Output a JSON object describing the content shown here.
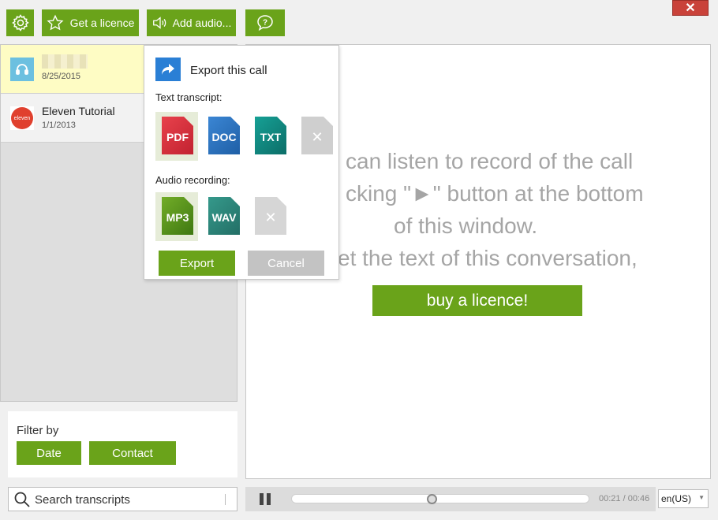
{
  "toolbar": {
    "settings_icon": "gear-icon",
    "licence_label": "Get a licence",
    "licence_icon": "star-icon",
    "audio_label": "Add audio...",
    "audio_icon": "speaker-icon",
    "help_icon": "question-bubble-icon",
    "close_icon": "close-icon"
  },
  "calls": [
    {
      "name": "",
      "date": "8/25/2015",
      "avatar": "headset-icon",
      "selected": true
    },
    {
      "name": "Eleven Tutorial",
      "date": "1/1/2013",
      "avatar": "eleven-logo",
      "avatar_text": "eleven",
      "selected": false
    }
  ],
  "filter": {
    "title": "Filter by",
    "date_label": "Date",
    "contact_label": "Contact"
  },
  "search": {
    "placeholder": "Search transcripts",
    "icon": "search-icon"
  },
  "main": {
    "lines": [
      "can listen to record of the call",
      "cking \"►\" button at the bottom",
      "of this window.",
      "et the text of this conversation,"
    ],
    "buy_label": "buy a licence!"
  },
  "player": {
    "time": "00:21 / 00:46",
    "progress": 0.47,
    "pause_icon": "pause-icon"
  },
  "language": {
    "value": "en(US)"
  },
  "export_popup": {
    "title": "Export this call",
    "icon": "share-arrow-icon",
    "text_label": "Text transcript:",
    "text_formats": [
      "PDF",
      "DOC",
      "TXT"
    ],
    "audio_label": "Audio recording:",
    "audio_formats": [
      "MP3",
      "WAV"
    ],
    "export_label": "Export",
    "cancel_label": "Cancel"
  },
  "colors": {
    "accent": "#6aa31a",
    "close": "#c9423a",
    "pdf": "#d9303c",
    "doc": "#2a74c2",
    "txt": "#0f8a83",
    "mp3": "#5f9a20",
    "wav": "#2e8a7e",
    "disabled": "#c9c9c9"
  }
}
